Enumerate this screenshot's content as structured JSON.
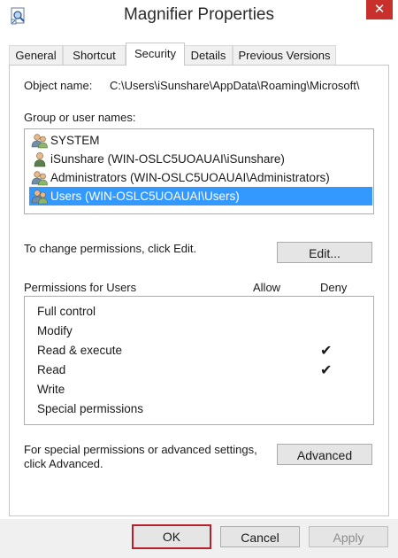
{
  "window": {
    "title": "Magnifier Properties",
    "close_glyph": "✕"
  },
  "tabs": [
    {
      "label": "General"
    },
    {
      "label": "Shortcut"
    },
    {
      "label": "Security",
      "active": true
    },
    {
      "label": "Details"
    },
    {
      "label": "Previous Versions"
    }
  ],
  "security": {
    "object_name_label": "Object name:",
    "object_name_value": "C:\\Users\\iSunshare\\AppData\\Roaming\\Microsoft\\",
    "group_label": "Group or user names:",
    "groups": [
      {
        "name": "SYSTEM"
      },
      {
        "name": "iSunshare (WIN-OSLC5UOAUAI\\iSunshare)"
      },
      {
        "name": "Administrators (WIN-OSLC5UOAUAI\\Administrators)"
      },
      {
        "name": "Users (WIN-OSLC5UOAUAI\\Users)",
        "selected": true
      }
    ],
    "change_hint": "To change permissions, click Edit.",
    "edit_button": "Edit...",
    "permissions_label": "Permissions for Users",
    "allow_header": "Allow",
    "deny_header": "Deny",
    "permissions": [
      {
        "name": "Full control",
        "allow": false,
        "deny": false
      },
      {
        "name": "Modify",
        "allow": false,
        "deny": false
      },
      {
        "name": "Read & execute",
        "allow": false,
        "deny": true
      },
      {
        "name": "Read",
        "allow": false,
        "deny": true
      },
      {
        "name": "Write",
        "allow": false,
        "deny": false
      },
      {
        "name": "Special permissions",
        "allow": false,
        "deny": false
      }
    ],
    "check_glyph": "✔",
    "advanced_hint_line1": "For special permissions or advanced settings,",
    "advanced_hint_line2": "click Advanced.",
    "advanced_button": "Advanced"
  },
  "footer": {
    "ok": "OK",
    "cancel": "Cancel",
    "apply": "Apply"
  },
  "colors": {
    "selection": "#3399ff",
    "close": "#c7302b",
    "default_button_border": "#b5202a"
  }
}
